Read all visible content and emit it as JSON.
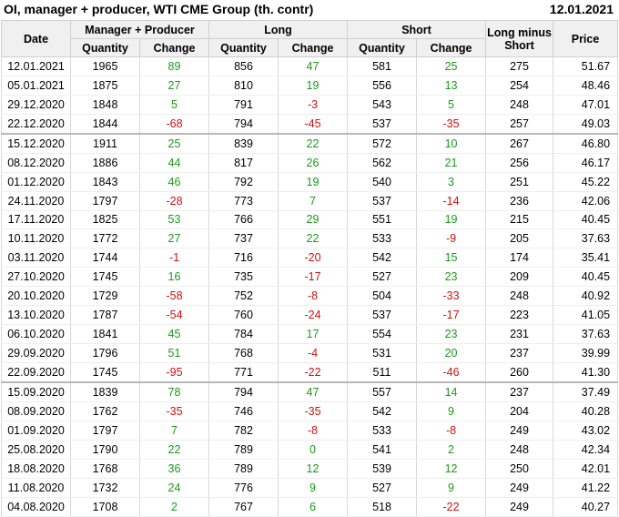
{
  "header": {
    "title": "OI, manager + producer, WTI CME Group (th. contr)",
    "date": "12.01.2021"
  },
  "columns": {
    "date": "Date",
    "manager_producer": "Manager + Producer",
    "long": "Long",
    "short": "Short",
    "long_minus_short": "Long minus Short",
    "price": "Price",
    "quantity": "Quantity",
    "change": "Change"
  },
  "rows": [
    [
      "12.01.2021",
      "1965",
      "89",
      "856",
      "47",
      "581",
      "25",
      "275",
      "51.67"
    ],
    [
      "05.01.2021",
      "1875",
      "27",
      "810",
      "19",
      "556",
      "13",
      "254",
      "48.46"
    ],
    [
      "29.12.2020",
      "1848",
      "5",
      "791",
      "-3",
      "543",
      "5",
      "248",
      "47.01"
    ],
    [
      "22.12.2020",
      "1844",
      "-68",
      "794",
      "-45",
      "537",
      "-35",
      "257",
      "49.03"
    ],
    [
      "15.12.2020",
      "1911",
      "25",
      "839",
      "22",
      "572",
      "10",
      "267",
      "46.80"
    ],
    [
      "08.12.2020",
      "1886",
      "44",
      "817",
      "26",
      "562",
      "21",
      "256",
      "46.17"
    ],
    [
      "01.12.2020",
      "1843",
      "46",
      "792",
      "19",
      "540",
      "3",
      "251",
      "45.22"
    ],
    [
      "24.11.2020",
      "1797",
      "-28",
      "773",
      "7",
      "537",
      "-14",
      "236",
      "42.06"
    ],
    [
      "17.11.2020",
      "1825",
      "53",
      "766",
      "29",
      "551",
      "19",
      "215",
      "40.45"
    ],
    [
      "10.11.2020",
      "1772",
      "27",
      "737",
      "22",
      "533",
      "-9",
      "205",
      "37.63"
    ],
    [
      "03.11.2020",
      "1744",
      "-1",
      "716",
      "-20",
      "542",
      "15",
      "174",
      "35.41"
    ],
    [
      "27.10.2020",
      "1745",
      "16",
      "735",
      "-17",
      "527",
      "23",
      "209",
      "40.45"
    ],
    [
      "20.10.2020",
      "1729",
      "-58",
      "752",
      "-8",
      "504",
      "-33",
      "248",
      "40.92"
    ],
    [
      "13.10.2020",
      "1787",
      "-54",
      "760",
      "-24",
      "537",
      "-17",
      "223",
      "41.05"
    ],
    [
      "06.10.2020",
      "1841",
      "45",
      "784",
      "17",
      "554",
      "23",
      "231",
      "37.63"
    ],
    [
      "29.09.2020",
      "1796",
      "51",
      "768",
      "-4",
      "531",
      "20",
      "237",
      "39.99"
    ],
    [
      "22.09.2020",
      "1745",
      "-95",
      "771",
      "-22",
      "511",
      "-46",
      "260",
      "41.30"
    ],
    [
      "15.09.2020",
      "1839",
      "78",
      "794",
      "47",
      "557",
      "14",
      "237",
      "37.49"
    ],
    [
      "08.09.2020",
      "1762",
      "-35",
      "746",
      "-35",
      "542",
      "9",
      "204",
      "40.28"
    ],
    [
      "01.09.2020",
      "1797",
      "7",
      "782",
      "-8",
      "533",
      "-8",
      "249",
      "43.02"
    ],
    [
      "25.08.2020",
      "1790",
      "22",
      "789",
      "0",
      "541",
      "2",
      "248",
      "42.34"
    ],
    [
      "18.08.2020",
      "1768",
      "36",
      "789",
      "12",
      "539",
      "12",
      "250",
      "42.01"
    ],
    [
      "11.08.2020",
      "1732",
      "24",
      "776",
      "9",
      "527",
      "9",
      "249",
      "41.22"
    ],
    [
      "04.08.2020",
      "1708",
      "2",
      "767",
      "6",
      "518",
      "-22",
      "249",
      "40.27"
    ]
  ],
  "colors": {
    "positive": "#1a9a1a",
    "negative": "#d01010",
    "header_bg": "#f0f0f0"
  }
}
